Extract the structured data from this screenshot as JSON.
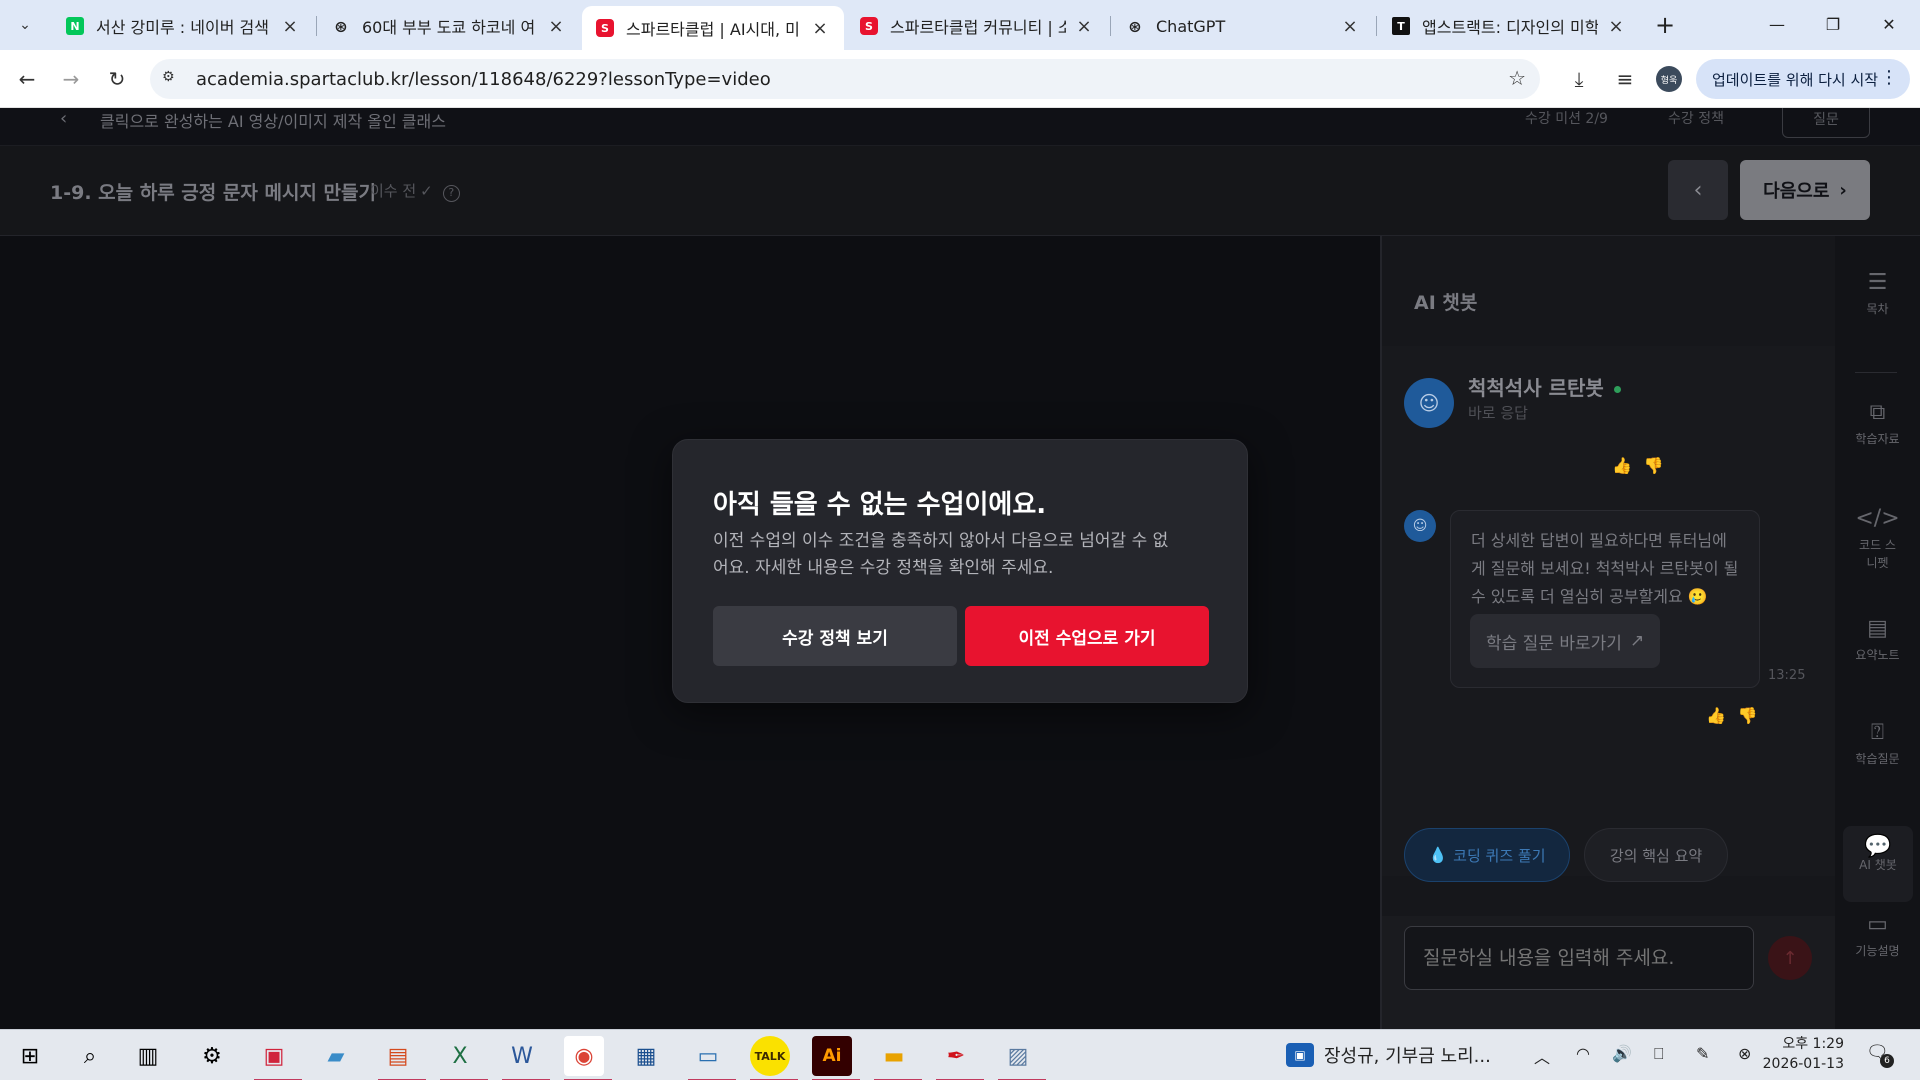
{
  "browser": {
    "tabs": [
      {
        "title": "서산 강미루 : 네이버 검색",
        "favicon": "N",
        "favicon_color": "#03c75a"
      },
      {
        "title": "60대 부부 도쿄 하코네 여",
        "favicon": "⊛",
        "favicon_color": "#222222"
      },
      {
        "title": "스파르타클럽 | AI시대, 미",
        "favicon": "S",
        "favicon_color": "#e8132f"
      },
      {
        "title": "스파르타클럽 커뮤니티 | 소",
        "favicon": "S",
        "favicon_color": "#e8132f"
      },
      {
        "title": "ChatGPT",
        "favicon": "⊛",
        "favicon_color": "#222222"
      },
      {
        "title": "앱스트랙트: 디자인의 미학",
        "favicon": "T",
        "favicon_color": "#111111"
      }
    ],
    "active_tab_index": 2,
    "url": "academia.spartaclub.kr/lesson/118648/6229?lessonType=video",
    "profile_initials": "형욱",
    "update_button": "업데이트를 위해 다시 시작"
  },
  "course": {
    "title": "클릭으로 완성하는 AI 영상/이미지 제작 올인 클래스",
    "progress": "수강 미션 2/9",
    "policy_link": "수강 정책",
    "question_button": "질문"
  },
  "lesson": {
    "title": "1-9. 오늘 하루 긍정 문자 메시지 만들기",
    "status": "이수 전",
    "next_button": "다음으로"
  },
  "chat": {
    "header": "AI 챗봇",
    "bot_name": "척척석사 르탄봇",
    "bot_subtitle": "바로 응답",
    "message": "더 상세한 답변이 필요하다면 튜터님에게 질문해 보세요! 척척박사 르탄봇이 될 수 있도록 더 열심히 공부할게요 🥲",
    "qa_link": "학습 질문 바로가기",
    "timestamp": "13:25",
    "chips": [
      "코딩 퀴즈 풀기",
      "강의 핵심 요약"
    ],
    "input_placeholder": "질문하실 내용을 입력해 주세요."
  },
  "rail": {
    "items": [
      {
        "icon": "list-icon",
        "label": "목차"
      },
      {
        "icon": "copy-icon",
        "label": "학습자료"
      },
      {
        "icon": "code-icon",
        "label": "코드 스니펫"
      },
      {
        "icon": "note-icon",
        "label": "요약노트"
      },
      {
        "icon": "question-icon",
        "label": "학습질문"
      },
      {
        "icon": "chat-icon",
        "label": "AI 챗봇"
      },
      {
        "icon": "book-icon",
        "label": "기능설명"
      }
    ],
    "active": "AI 챗봇"
  },
  "modal": {
    "title": "아직 들을 수 없는 수업이에요.",
    "description": "이전 수업의 이수 조건을 충족하지 않아서 다음으로 넘어갈 수 없어요. 자세한 내용은 수강 정책을 확인해 주세요.",
    "secondary_button": "수강 정책 보기",
    "primary_button": "이전 수업으로 가기",
    "accent_color": "#e8132f"
  },
  "taskbar": {
    "notification_text": "장성규, 기부금 노리...",
    "clock_time": "오후 1:29",
    "clock_date": "2026-01-13",
    "notification_count": "6"
  }
}
